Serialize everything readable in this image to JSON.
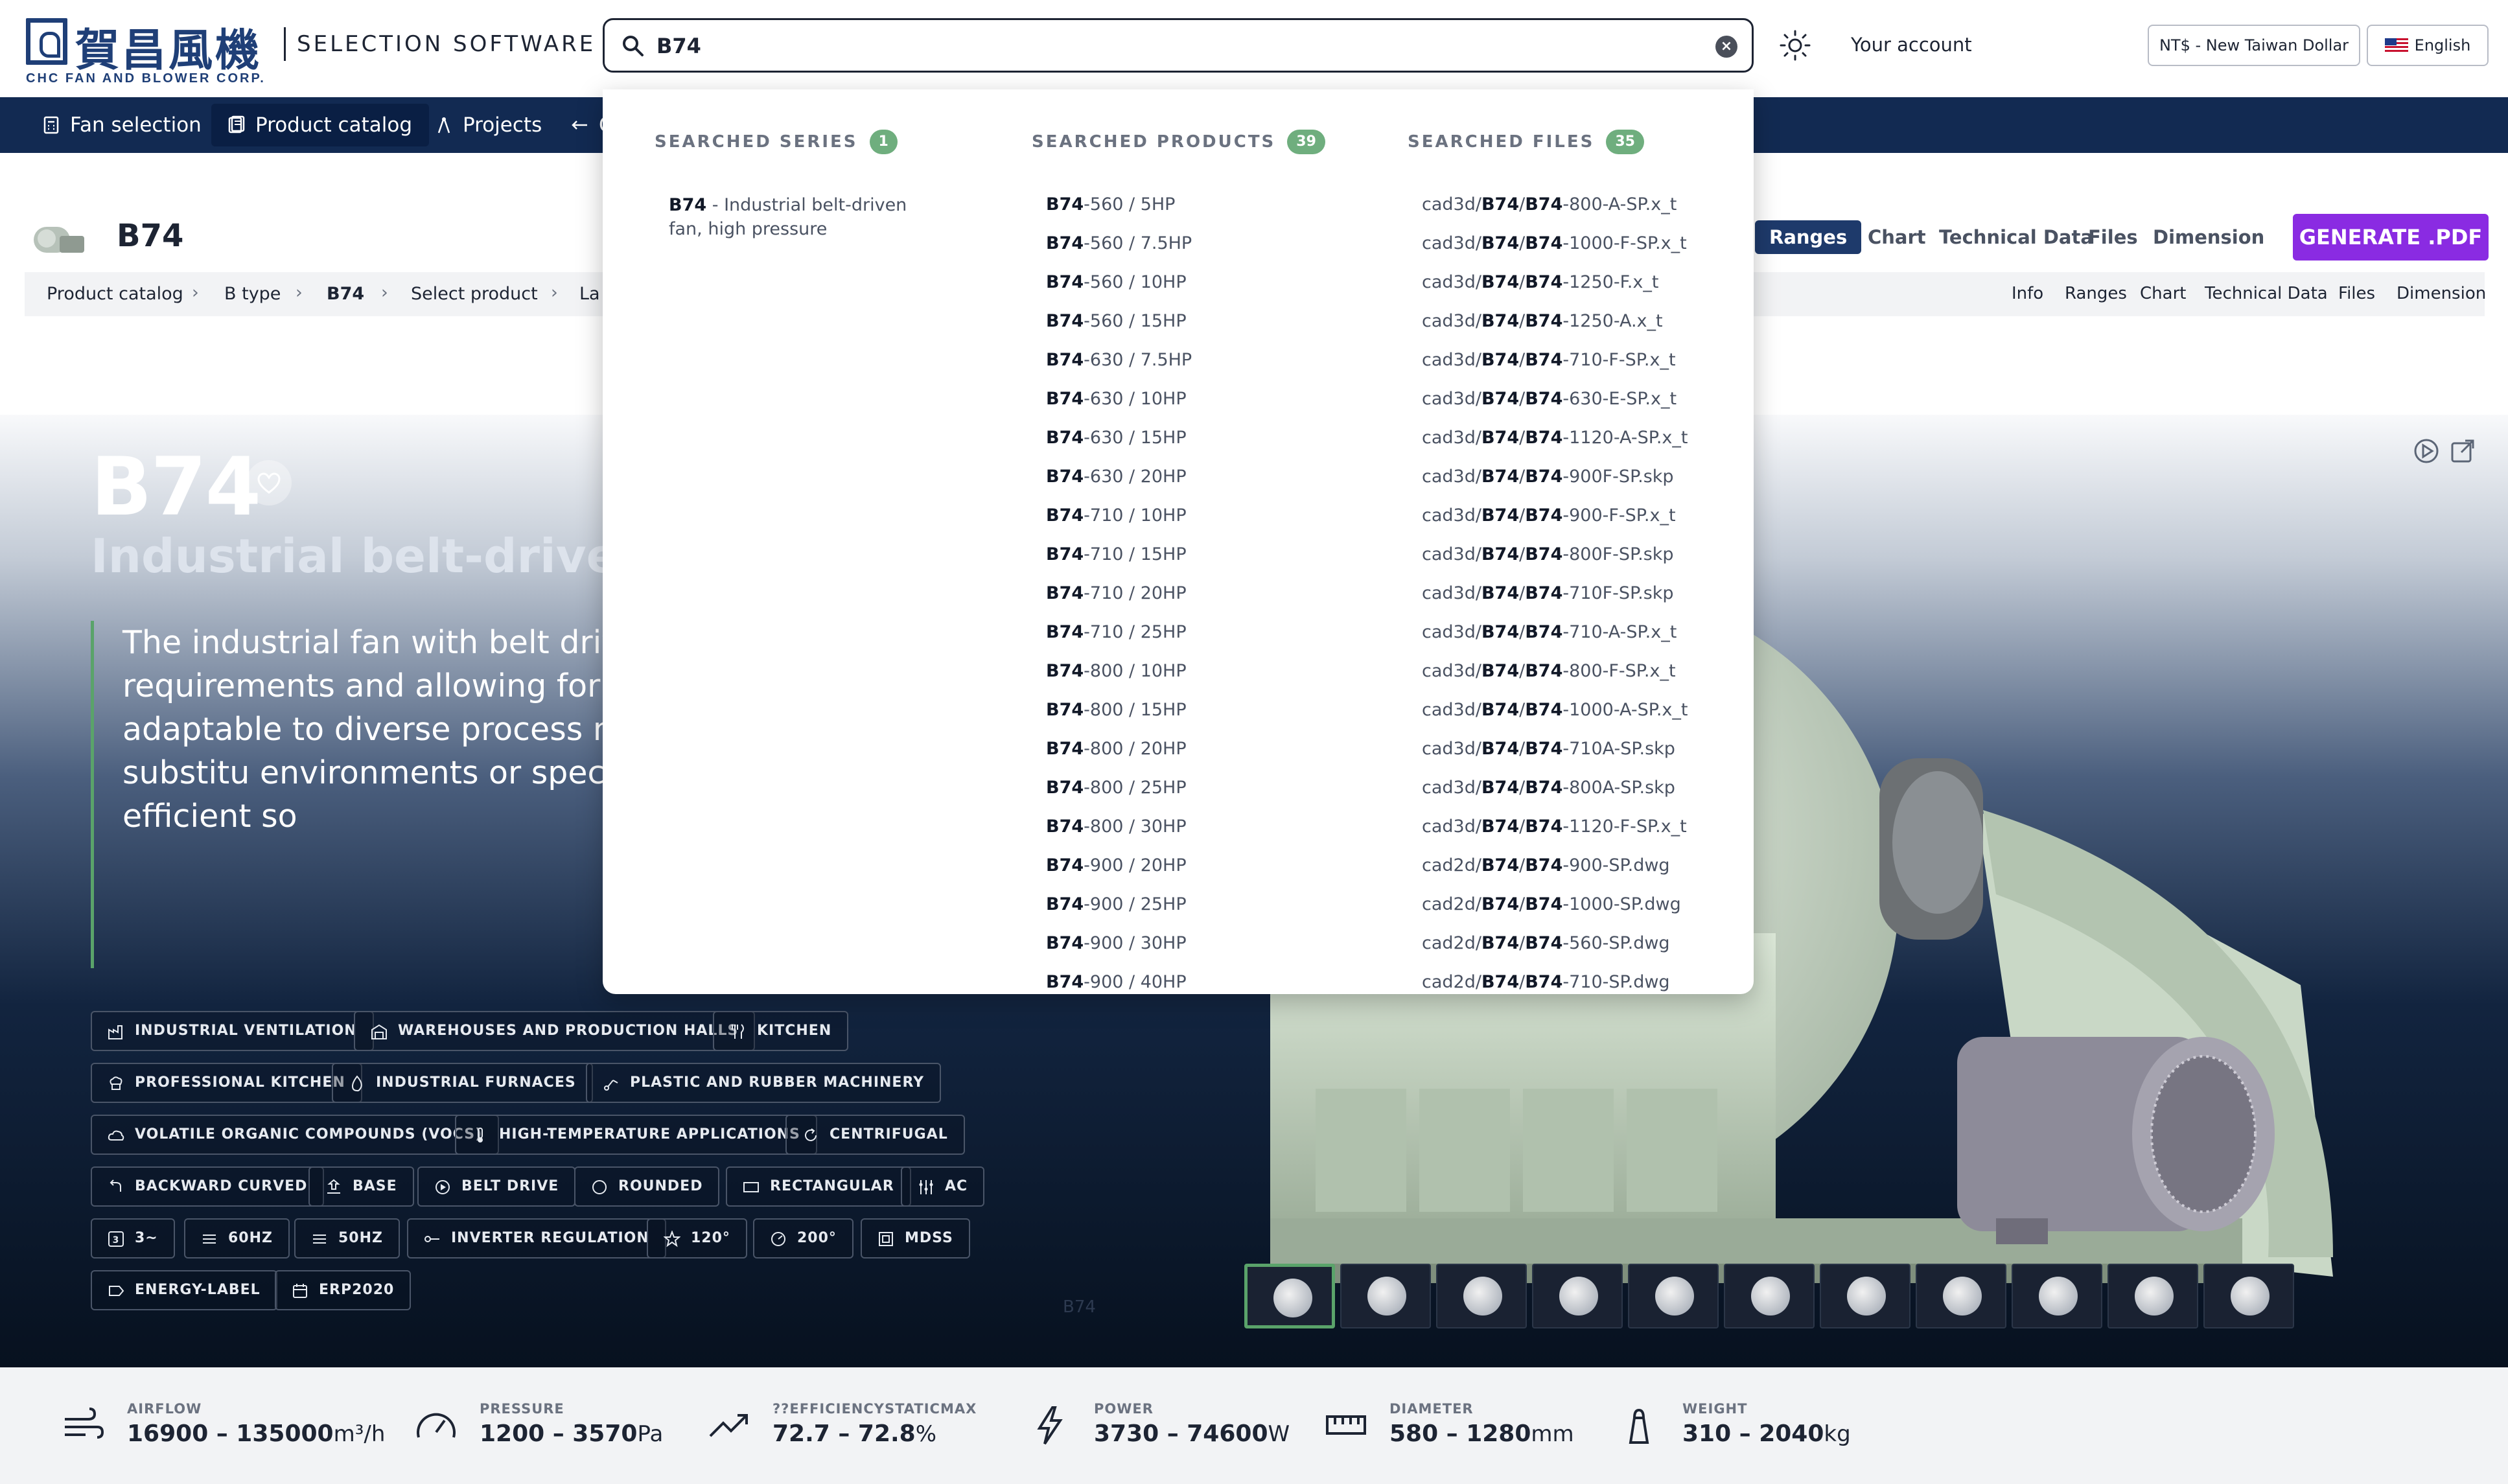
{
  "header": {
    "logo_cn": "賀昌風機",
    "logo_en": "CHC FAN AND BLOWER CORP.",
    "app_name": "SELECTION SOFTWARE",
    "search_value": "B74",
    "account": "Your account",
    "currency": "NT$ - New Taiwan Dollar",
    "language": "English"
  },
  "nav": {
    "items": [
      {
        "label": "Fan selection",
        "icon": "calculator-icon"
      },
      {
        "label": "Product catalog",
        "icon": "catalog-icon"
      },
      {
        "label": "Projects",
        "icon": "compass-icon"
      },
      {
        "label": "C",
        "icon": "compare-icon"
      }
    ]
  },
  "product": {
    "code": "B74",
    "tabs": [
      "Ranges",
      "Chart",
      "Technical Data",
      "Files",
      "Dimension"
    ],
    "pdf_button": "GENERATE .PDF",
    "breadcrumb": [
      "Product catalog",
      "B type",
      "B74",
      "Select product",
      "La"
    ],
    "subtabs": [
      "Info",
      "Ranges",
      "Chart",
      "Technical Data",
      "Files",
      "Dimension"
    ]
  },
  "hero": {
    "title": "B74",
    "subtitle": "Industrial belt-driven fa",
    "description": "The industrial fan with belt drive fe performance characteristics, meet requirements and allowing for cust high-temperature resistance based adaptable to diverse process needs modifications and material substitu environments or specific process d fan provides stable and efficient so",
    "watermark": "B74",
    "chips": [
      [
        "INDUSTRIAL VENTILATION",
        "WAREHOUSES AND PRODUCTION HALLS",
        "KITCHEN"
      ],
      [
        "PROFESSIONAL KITCHEN",
        "INDUSTRIAL FURNACES",
        "PLASTIC AND RUBBER MACHINERY"
      ],
      [
        "VOLATILE ORGANIC COMPOUNDS (VOCS)",
        "HIGH-TEMPERATURE APPLICATIONS",
        "CENTRIFUGAL"
      ],
      [
        "BACKWARD CURVED",
        "BASE",
        "BELT DRIVE",
        "ROUNDED",
        "RECTANGULAR",
        "AC"
      ],
      [
        "3~",
        "60HZ",
        "50HZ",
        "INVERTER REGULATION",
        "120°",
        "200°",
        "MDSS"
      ],
      [
        "ENERGY-LABEL",
        "ERP2020"
      ]
    ]
  },
  "stats": [
    {
      "label": "AIRFLOW",
      "value": "16900 – 135000",
      "unit": "m³/h",
      "icon": "airflow-icon"
    },
    {
      "label": "PRESSURE",
      "value": "1200 – 3570",
      "unit": "Pa",
      "icon": "gauge-icon"
    },
    {
      "label": "??EFFICIENCYSTATICMAX",
      "value": "72.7 – 72.8",
      "unit": "%",
      "icon": "trend-icon"
    },
    {
      "label": "POWER",
      "value": "3730 – 74600",
      "unit": "W",
      "icon": "bolt-icon"
    },
    {
      "label": "DIAMETER",
      "value": "580 – 1280",
      "unit": "mm",
      "icon": "ruler-icon"
    },
    {
      "label": "WEIGHT",
      "value": "310 – 2040",
      "unit": "kg",
      "icon": "weight-icon"
    }
  ],
  "dropdown": {
    "series": {
      "heading": "SEARCHED SERIES",
      "count": "1",
      "items": [
        {
          "code": "B74",
          "text": " - Industrial belt-driven fan, high pressure"
        }
      ]
    },
    "products": {
      "heading": "SEARCHED PRODUCTS",
      "count": "39",
      "items": [
        "-560 / 5HP",
        "-560 / 7.5HP",
        "-560 / 10HP",
        "-560 / 15HP",
        "-630 / 7.5HP",
        "-630 / 10HP",
        "-630 / 15HP",
        "-630 / 20HP",
        "-710 / 10HP",
        "-710 / 15HP",
        "-710 / 20HP",
        "-710 / 25HP",
        "-800 / 10HP",
        "-800 / 15HP",
        "-800 / 20HP",
        "-800 / 25HP",
        "-800 / 30HP",
        "-900 / 20HP",
        "-900 / 25HP",
        "-900 / 30HP",
        "-900 / 40HP"
      ]
    },
    "files": {
      "heading": "SEARCHED FILES",
      "count": "35",
      "items": [
        [
          "cad3d/",
          "-800-A-SP.x_t"
        ],
        [
          "cad3d/",
          "-1000-F-SP.x_t"
        ],
        [
          "cad3d/",
          "-1250-F.x_t"
        ],
        [
          "cad3d/",
          "-1250-A.x_t"
        ],
        [
          "cad3d/",
          "-710-F-SP.x_t"
        ],
        [
          "cad3d/",
          "-630-E-SP.x_t"
        ],
        [
          "cad3d/",
          "-1120-A-SP.x_t"
        ],
        [
          "cad3d/",
          "-900F-SP.skp"
        ],
        [
          "cad3d/",
          "-900-F-SP.x_t"
        ],
        [
          "cad3d/",
          "-800F-SP.skp"
        ],
        [
          "cad3d/",
          "-710F-SP.skp"
        ],
        [
          "cad3d/",
          "-710-A-SP.x_t"
        ],
        [
          "cad3d/",
          "-800-F-SP.x_t"
        ],
        [
          "cad3d/",
          "-1000-A-SP.x_t"
        ],
        [
          "cad3d/",
          "-710A-SP.skp"
        ],
        [
          "cad3d/",
          "-800A-SP.skp"
        ],
        [
          "cad3d/",
          "-1120-F-SP.x_t"
        ],
        [
          "cad2d/",
          "-900-SP.dwg"
        ],
        [
          "cad2d/",
          "-1000-SP.dwg"
        ],
        [
          "cad2d/",
          "-560-SP.dwg"
        ],
        [
          "cad2d/",
          "-710-SP.dwg"
        ]
      ]
    }
  },
  "colors": {
    "nav_bg": "#122a52",
    "accent_purple": "#8a2be2",
    "badge_green": "#6fae7e",
    "active_tab": "#1e3a6b"
  }
}
